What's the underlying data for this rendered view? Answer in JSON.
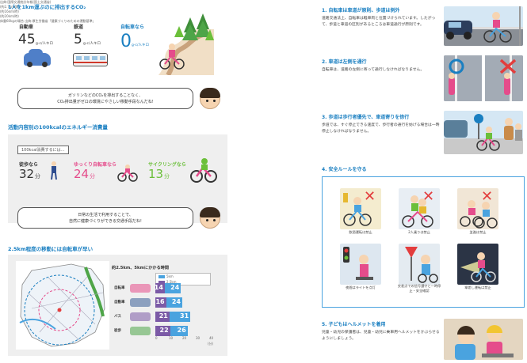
{
  "colors": {
    "accent": "#1a7fc1",
    "ride": "#e54c8b",
    "bike_green": "#6bbf3a",
    "bar_purple": "#7b5aa6",
    "bar_blue": "#4aa3df"
  },
  "section1": {
    "title": "1人を1km運ぶのに排出するCO₂",
    "car": {
      "label": "自動車",
      "value": "45",
      "unit": "g-c/人キロ"
    },
    "train": {
      "label": "鉄道",
      "value": "5",
      "unit": "g-c/人キロ"
    },
    "bike": {
      "label": "自転車なら",
      "value": "0",
      "unit": "g-c/人キロ"
    },
    "source": "出典:国際交通統計年報(国土交通省)",
    "bubble": [
      "ガソリンなどのCO₂を排出することなく、",
      "CO₂排出量がゼロの環境にやさしい移動手段なんだね!"
    ]
  },
  "section2": {
    "title": "活動内容別の100kcalのエネルギー消費量",
    "header": "100kcal消費するには…",
    "walk": {
      "label": "徒歩なら",
      "value": "32",
      "unit": "分",
      "sub": "(約2.7km/時)"
    },
    "slow": {
      "label": "ゆっくり自転車なら",
      "value": "24",
      "unit": "分",
      "sub": "(約16km/時)"
    },
    "cycling": {
      "label": "サイクリングなら",
      "value": "13",
      "unit": "分",
      "sub": "(約20km/時)"
    },
    "source": "体重60kgの場合 出典:厚生労働省「健康づくりのための運動基準」",
    "bubble": [
      "日常の生活で利用することで、",
      "自然に健康づくりができる交通手段だね!"
    ]
  },
  "section3": {
    "title": "2.5km程度の移動には自転車が早い",
    "chart_title": "約2.5km、5kmにかかる時間",
    "legend": [
      "5km",
      "2.5km"
    ],
    "axis_labels": [
      "0",
      "10",
      "20",
      "30",
      "40",
      "50",
      "60",
      "70",
      "80",
      "90",
      "100"
    ],
    "axis_unit": "(分)"
  },
  "chart_data": {
    "type": "bar",
    "title": "約2.5km、5kmにかかる時間",
    "xlabel": "(分)",
    "categories": [
      "自転車",
      "自動車",
      "バス",
      "徒歩"
    ],
    "series": [
      {
        "name": "2.5km",
        "values": [
          14,
          16,
          21,
          22
        ]
      },
      {
        "name": "5km",
        "values": [
          24,
          24,
          31,
          26
        ]
      }
    ]
  },
  "right": {
    "r1": {
      "title": "1. 自転車は車道が原則、歩道は例外",
      "text": "道路交通法上、自転車は軽車両と位置づけられています。したがって、歩道と車道の区別があるところは車道通行が原則です。"
    },
    "r2": {
      "title": "2. 車道は左側を通行",
      "text": "自転車は、道路の左側に寄って通行しなければなりません。"
    },
    "r3": {
      "title": "3. 歩道は歩行者優先で、車道寄りを徐行",
      "text": "歩道では、すぐ停止できる速度で、歩行者の通行を妨げる場合は一時停止しなければなりません。"
    },
    "r4": {
      "title": "4. 安全ルールを守る",
      "rules": [
        "飲酒運転は禁止",
        "2人乗りは禁止",
        "並進は禁止",
        "夜間はライトを点灯",
        "交差点での信号遵守と一時停止・安全確認",
        "傘差し運転は禁止"
      ]
    },
    "r5": {
      "title": "5. 子どもはヘルメットを着用",
      "text": "児童・幼児の保護者は、児童・幼児に乗車用ヘルメットをかぶらせるようにしましょう。"
    }
  }
}
